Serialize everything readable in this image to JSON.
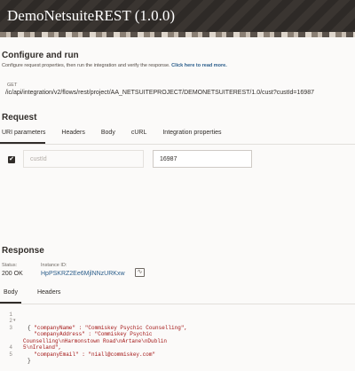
{
  "header": {
    "title": "DemoNetsuiteREST (1.0.0)"
  },
  "configure": {
    "title": "Configure and run",
    "description": "Configure request properties, then run the integration and verify the response.",
    "help_link": "Click here to read more.",
    "method": "GET",
    "url": "/ic/api/integration/v2/flows/rest/project/AA_NETSUITEPROJECT/DEMONETSUITEREST/1.0/cust?custId=16987"
  },
  "request": {
    "title": "Request",
    "tabs": [
      {
        "label": "URI parameters"
      },
      {
        "label": "Headers"
      },
      {
        "label": "Body"
      },
      {
        "label": "cURL"
      },
      {
        "label": "Integration properties"
      }
    ],
    "active_tab": "URI parameters",
    "param": {
      "checked": true,
      "name_placeholder": "custId",
      "value": "16987"
    }
  },
  "response": {
    "title": "Response",
    "status_label": "Status:",
    "status_value": "200 OK",
    "instance_label": "Instance ID:",
    "instance_value": "HpPSKRZ2Ee6MjlNNzURKxw",
    "tabs": [
      {
        "label": "Body"
      },
      {
        "label": "Headers"
      }
    ],
    "active_tab": "Body",
    "code_lines": [
      {
        "num": "1",
        "fold": "▾",
        "text": "{"
      },
      {
        "num": "2",
        "fold": "",
        "text": "  \"companyName\" : \"Commiskey Psychic Counselling\","
      },
      {
        "num": "3",
        "fold": "",
        "text": "  \"companyAddress\" : \"Commiskey Psychic"
      },
      {
        "num": "",
        "fold": "",
        "text": "Counselling\\nHarmonstown Road\\nArtane\\nDublin"
      },
      {
        "num": "",
        "fold": "",
        "text": "5\\nIreland\","
      },
      {
        "num": "4",
        "fold": "",
        "text": "  \"companyEmail\" : \"niall@commiskey.com\""
      },
      {
        "num": "5",
        "fold": "",
        "text": "}"
      }
    ]
  }
}
